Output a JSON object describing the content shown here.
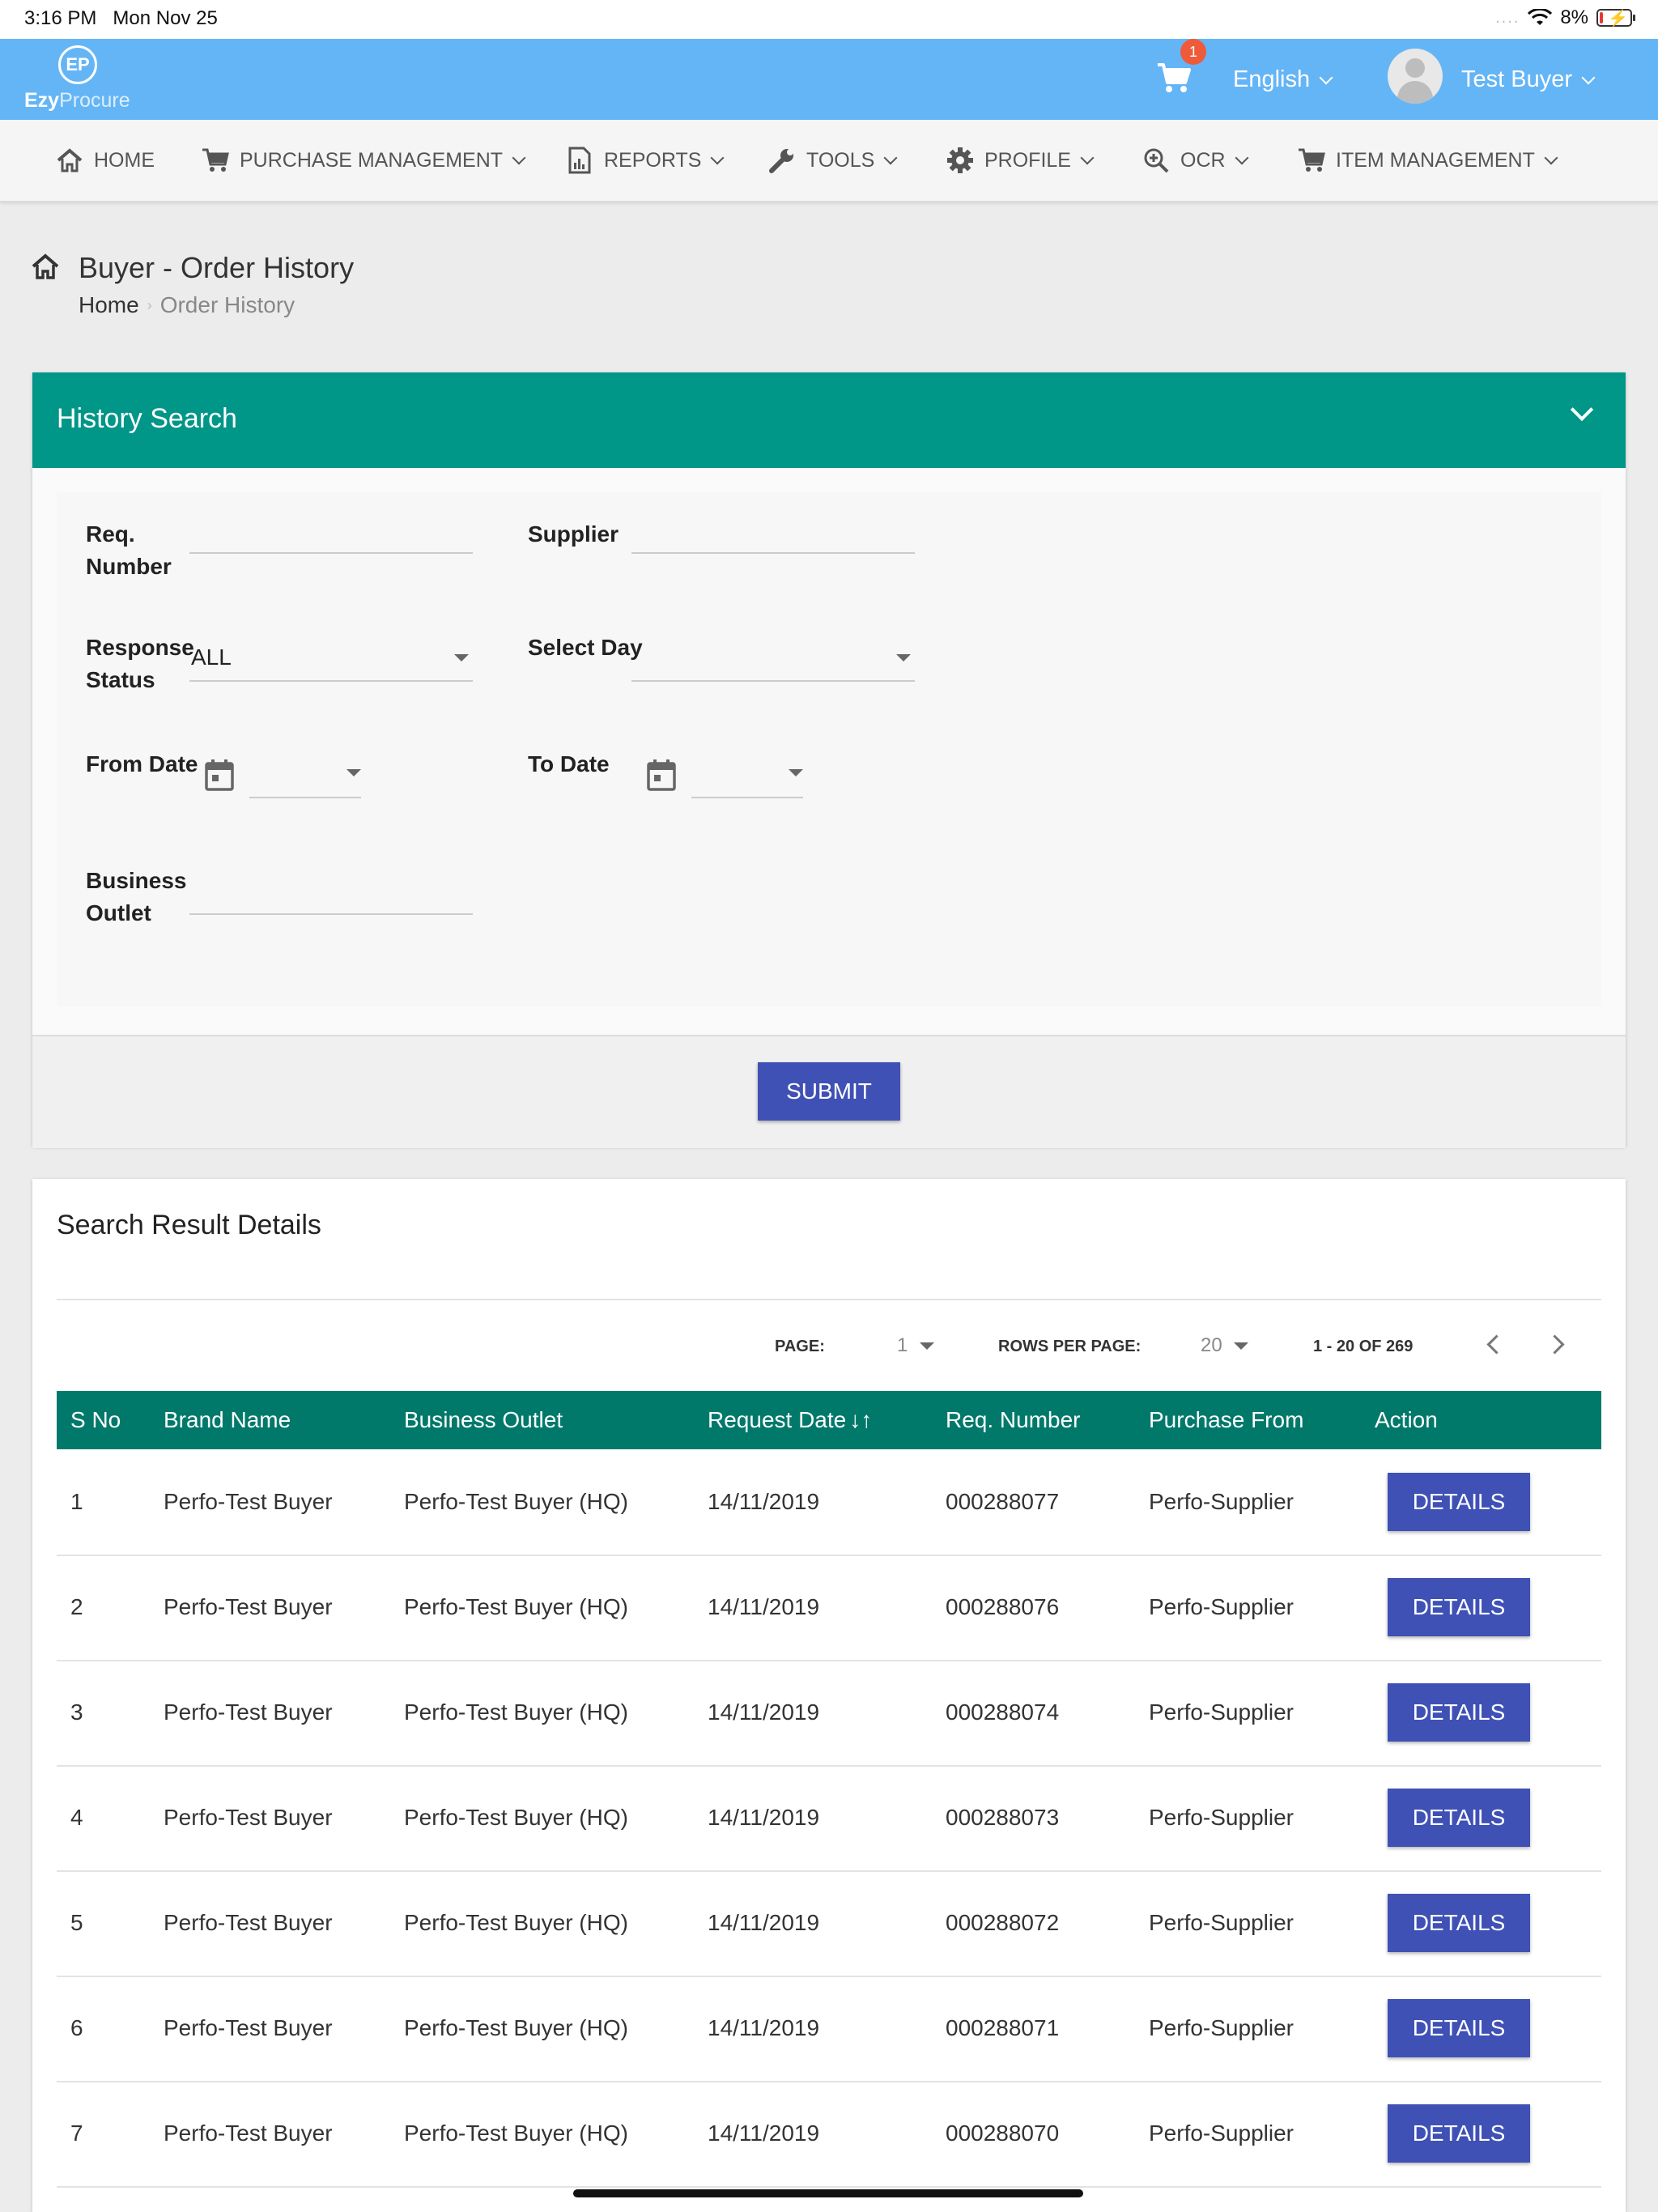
{
  "status_bar": {
    "time": "3:16 PM",
    "date": "Mon Nov 25",
    "battery": "8%"
  },
  "app": {
    "logo_bold": "Ezy",
    "logo_light": "Procure",
    "logo_mark": "EP",
    "cart_count": "1",
    "language": "English",
    "user_name": "Test Buyer",
    "brand_color": "#64b5f6"
  },
  "nav": {
    "items": [
      {
        "label": "HOME",
        "icon": "home-icon"
      },
      {
        "label": "PURCHASE MANAGEMENT",
        "icon": "cart-icon"
      },
      {
        "label": "REPORTS",
        "icon": "report-icon"
      },
      {
        "label": "TOOLS",
        "icon": "wrench-icon"
      },
      {
        "label": "PROFILE",
        "icon": "gear-icon"
      },
      {
        "label": "OCR",
        "icon": "zoom-icon"
      },
      {
        "label": "ITEM MANAGEMENT",
        "icon": "cart-icon"
      }
    ]
  },
  "page": {
    "title": "Buyer - Order History",
    "breadcrumb": [
      "Home",
      "Order History"
    ]
  },
  "search": {
    "title": "History Search",
    "header_color": "#009688",
    "fields": {
      "req_number": {
        "label_1": "Req.",
        "label_2": "Number",
        "value": ""
      },
      "supplier": {
        "label": "Supplier",
        "value": ""
      },
      "response_status": {
        "label_1": "Response",
        "label_2": "Status",
        "value": "ALL"
      },
      "select_day": {
        "label": "Select Day",
        "value": ""
      },
      "from_date": {
        "label": "From Date",
        "value": ""
      },
      "to_date": {
        "label": "To Date",
        "value": ""
      },
      "business_outlet": {
        "label_1": "Business",
        "label_2": "Outlet",
        "value": ""
      }
    },
    "submit_label": "SUBMIT"
  },
  "results": {
    "title": "Search Result Details",
    "pager": {
      "page_label": "PAGE:",
      "page_value": "1",
      "rows_label": "ROWS PER PAGE:",
      "rows_value": "20",
      "range": "1 - 20 OF 269"
    },
    "header_color": "#00796b",
    "columns": [
      "S No",
      "Brand Name",
      "Business Outlet",
      "Request Date",
      "Req. Number",
      "Purchase From",
      "Action"
    ],
    "rows": [
      {
        "sno": "1",
        "brand": "Perfo-Test Buyer",
        "outlet": "Perfo-Test Buyer (HQ)",
        "date": "14/11/2019",
        "req": "000288077",
        "from": "Perfo-Supplier",
        "action": "DETAILS"
      },
      {
        "sno": "2",
        "brand": "Perfo-Test Buyer",
        "outlet": "Perfo-Test Buyer (HQ)",
        "date": "14/11/2019",
        "req": "000288076",
        "from": "Perfo-Supplier",
        "action": "DETAILS"
      },
      {
        "sno": "3",
        "brand": "Perfo-Test Buyer",
        "outlet": "Perfo-Test Buyer (HQ)",
        "date": "14/11/2019",
        "req": "000288074",
        "from": "Perfo-Supplier",
        "action": "DETAILS"
      },
      {
        "sno": "4",
        "brand": "Perfo-Test Buyer",
        "outlet": "Perfo-Test Buyer (HQ)",
        "date": "14/11/2019",
        "req": "000288073",
        "from": "Perfo-Supplier",
        "action": "DETAILS"
      },
      {
        "sno": "5",
        "brand": "Perfo-Test Buyer",
        "outlet": "Perfo-Test Buyer (HQ)",
        "date": "14/11/2019",
        "req": "000288072",
        "from": "Perfo-Supplier",
        "action": "DETAILS"
      },
      {
        "sno": "6",
        "brand": "Perfo-Test Buyer",
        "outlet": "Perfo-Test Buyer (HQ)",
        "date": "14/11/2019",
        "req": "000288071",
        "from": "Perfo-Supplier",
        "action": "DETAILS"
      },
      {
        "sno": "7",
        "brand": "Perfo-Test Buyer",
        "outlet": "Perfo-Test Buyer (HQ)",
        "date": "14/11/2019",
        "req": "000288070",
        "from": "Perfo-Supplier",
        "action": "DETAILS"
      }
    ]
  }
}
